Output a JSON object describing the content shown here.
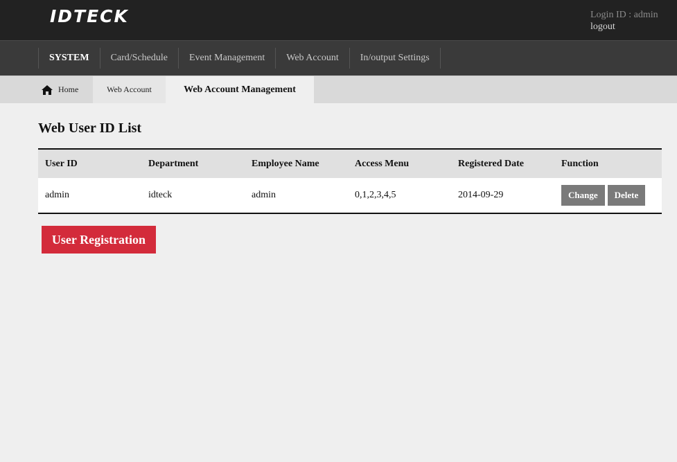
{
  "header": {
    "logo": "IDTECK",
    "login_id": "Login ID : admin",
    "logout": "logout"
  },
  "nav": {
    "items": [
      {
        "label": "SYSTEM"
      },
      {
        "label": "Card/Schedule"
      },
      {
        "label": "Event Management"
      },
      {
        "label": "Web Account"
      },
      {
        "label": "In/output Settings"
      }
    ]
  },
  "breadcrumb": {
    "home": "Home",
    "section": "Web Account",
    "current": "Web Account Management"
  },
  "main": {
    "title": "Web User ID List",
    "table": {
      "headers": [
        "User ID",
        "Department",
        "Employee Name",
        "Access Menu",
        "Registered Date",
        "Function"
      ],
      "rows": [
        {
          "user_id": "admin",
          "department": "idteck",
          "employee_name": "admin",
          "access_menu": "0,1,2,3,4,5",
          "registered_date": "2014-09-29",
          "change_label": "Change",
          "delete_label": "Delete"
        }
      ]
    },
    "register_label": "User Registration"
  },
  "colors": {
    "header_bg": "#222222",
    "nav_bg": "#3a3a3a",
    "accent_red": "#d32b3b",
    "button_gray": "#7a7a7a"
  },
  "icons": {
    "home": "home-icon"
  }
}
